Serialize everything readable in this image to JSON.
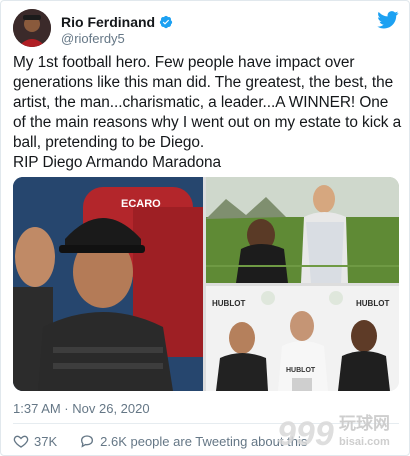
{
  "author": {
    "display_name": "Rio Ferdinand",
    "handle": "@rioferdy5",
    "verified": true
  },
  "tweet": {
    "text": "My 1st football hero. Few people have impact over generations like this man did. The greatest, the best, the artist, the man...charismatic, a leader...A WINNER! One of the main reasons why I went out on my estate to kick a ball, pretending to be Diego.\nRIP Diego Armando Maradona",
    "timestamp": "1:37 AM · Nov 26, 2020"
  },
  "media": {
    "photo_1_text": "ECARO",
    "photo_3_text_1": "HUBLOT",
    "photo_3_text_2": "HUBLOT",
    "photo_3_text_3": "HUBLOT"
  },
  "actions": {
    "like_count": "37K",
    "reply_text": "2.6K people are Tweeting about this"
  },
  "watermark": {
    "text": "玩球网",
    "sub_text": "bisai.com"
  },
  "colors": {
    "twitter_blue": "#1da1f2",
    "text_primary": "#14171a",
    "text_secondary": "#657786",
    "border": "#e1e8ed"
  }
}
